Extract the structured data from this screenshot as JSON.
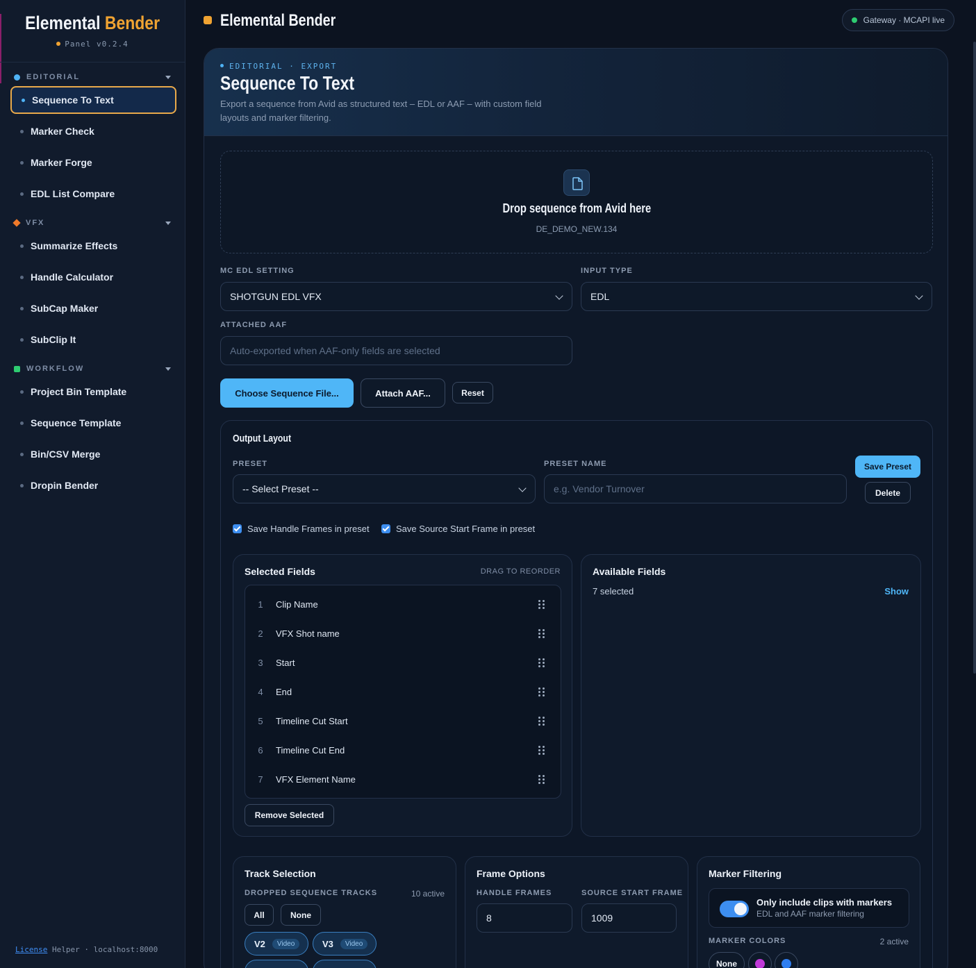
{
  "sidebar": {
    "brand": {
      "name_white": "Elemental",
      "name_orange": "Bender",
      "version": "Panel v0.2.4"
    },
    "sections": [
      {
        "label": "EDITORIAL",
        "items": [
          "Sequence To Text",
          "Marker Check",
          "Marker Forge",
          "EDL List Compare"
        ]
      },
      {
        "label": "VFX",
        "items": [
          "Summarize Effects",
          "Handle Calculator",
          "SubCap Maker",
          "SubClip It"
        ]
      },
      {
        "label": "WORKFLOW",
        "items": [
          "Project Bin Template",
          "Sequence Template",
          "Bin/CSV Merge",
          "Dropin Bender"
        ]
      }
    ],
    "active_item": "Sequence To Text",
    "footer": {
      "license_link": "License",
      "helper_text": "Helper · localhost:8000"
    }
  },
  "topbar": {
    "title": "Elemental Bender",
    "status": "Gateway · MCAPI live"
  },
  "hero": {
    "breadcrumb": "EDITORIAL · EXPORT",
    "title": "Sequence To Text",
    "description": "Export a sequence from Avid as structured text – EDL or AAF – with custom field layouts and marker filtering."
  },
  "dropzone": {
    "title": "Drop sequence from Avid here",
    "filename": "DE_DEMO_NEW.134",
    "icon": "file-icon"
  },
  "form": {
    "mc_edl_label": "MC EDL SETTING",
    "mc_edl_value": "SHOTGUN EDL VFX",
    "input_type_label": "INPUT TYPE",
    "input_type_value": "EDL",
    "attached_aaf_label": "ATTACHED AAF",
    "attached_aaf_placeholder": "Auto-exported when AAF-only fields are selected",
    "choose_btn": "Choose Sequence File...",
    "attach_btn": "Attach AAF...",
    "reset_btn": "Reset"
  },
  "output_layout": {
    "title": "Output Layout",
    "preset_label": "PRESET",
    "preset_value": "-- Select Preset --",
    "preset_name_label": "PRESET NAME",
    "preset_name_placeholder": "e.g. Vendor Turnover",
    "save_btn": "Save Preset",
    "delete_btn": "Delete",
    "check_handles": "Save Handle Frames in preset",
    "check_source": "Save Source Start Frame in preset"
  },
  "selected_fields": {
    "title": "Selected Fields",
    "hint": "DRAG TO REORDER",
    "fields": [
      "Clip Name",
      "VFX Shot name",
      "Start",
      "End",
      "Timeline Cut Start",
      "Timeline Cut End",
      "VFX Element Name"
    ],
    "remove_btn": "Remove Selected"
  },
  "available_fields": {
    "title": "Available Fields",
    "count": "7 selected",
    "show_link": "Show"
  },
  "track_selection": {
    "title": "Track Selection",
    "label": "DROPPED SEQUENCE TRACKS",
    "active": "10 active",
    "all_btn": "All",
    "none_btn": "None",
    "tracks": [
      {
        "name": "V2",
        "type": "Video"
      },
      {
        "name": "V3",
        "type": "Video"
      }
    ]
  },
  "frame_options": {
    "title": "Frame Options",
    "handle_label": "HANDLE FRAMES",
    "handle_value": "8",
    "source_label": "SOURCE START FRAME",
    "source_value": "1009"
  },
  "marker_filtering": {
    "title": "Marker Filtering",
    "toggle_title": "Only include clips with markers",
    "toggle_sub": "EDL and AAF marker filtering",
    "colors_label": "MARKER COLORS",
    "colors_active": "2 active",
    "none_btn": "None",
    "colors": [
      "#c03ad8",
      "#2f7ef0"
    ]
  },
  "colors": {
    "accent": "#4fb6f7",
    "brand_orange": "#f0a332",
    "active_border": "#e9a94a",
    "status_green": "#2ecc71"
  }
}
